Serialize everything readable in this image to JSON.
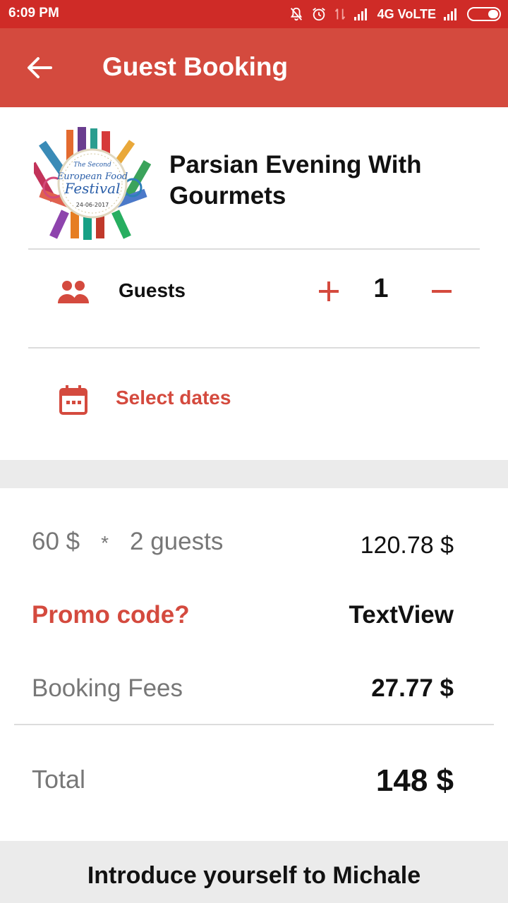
{
  "status_bar": {
    "time": "6:09 PM",
    "network": "4G VoLTE",
    "icons": [
      "mute-icon",
      "alarm-icon",
      "data-transfer-icon",
      "signal-icon",
      "signal-icon",
      "battery-icon"
    ]
  },
  "app_bar": {
    "title": "Guest Booking",
    "back_icon": "arrow-left-icon",
    "color": "#d44a3e"
  },
  "event": {
    "title": "Parsian Evening With Gourmets",
    "logo_text": {
      "line1": "The Second",
      "line2": "European Food",
      "line3": "Festival",
      "date": "24-06-2017"
    }
  },
  "guests": {
    "label": "Guests",
    "count": "1",
    "icon": "people-icon",
    "increment_icon": "plus-icon",
    "decrement_icon": "minus-icon"
  },
  "dates": {
    "label": "Select dates",
    "icon": "calendar-icon"
  },
  "pricing": {
    "unit_price": "60 $",
    "multiply": "*",
    "guests_text": "2 guests",
    "subtotal": "120.78 $",
    "promo_label": "Promo code?",
    "promo_value": "TextView",
    "fees_label": "Booking Fees",
    "fees_value": "27.77 $",
    "total_label": "Total",
    "total_value": "148 $"
  },
  "footer": {
    "intro": "Introduce yourself to Michale"
  },
  "colors": {
    "status_bar": "#cf2b27",
    "accent": "#d44a3e",
    "band": "#ebebeb"
  }
}
